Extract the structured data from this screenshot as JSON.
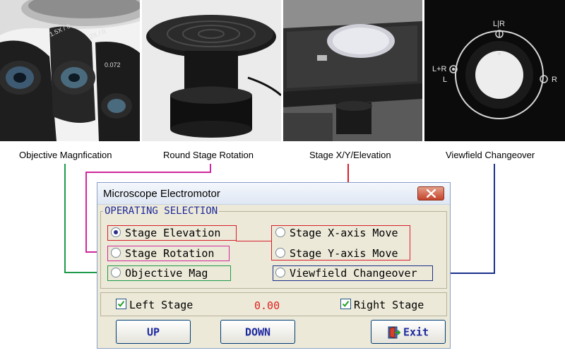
{
  "captions": {
    "objective": "Objective Magnfication",
    "round_stage": "Round Stage Rotation",
    "stage_xy": "Stage X/Y/Elevation",
    "viewfield": "Viewfield Changeover"
  },
  "photos": {
    "objective_label_a": "1.5X / 0",
    "objective_label_b": "2X / 0.",
    "objective_label_c": "0.072",
    "dial_top": "L|R",
    "dial_left_top": "L+R",
    "dial_left": "L",
    "dial_right": "R"
  },
  "dialog": {
    "title": "Microscope Electromotor",
    "group_label": "OPERATING SELECTION",
    "options": {
      "stage_elevation": "Stage Elevation",
      "stage_rotation": "Stage Rotation",
      "objective_mag": "Objective Mag",
      "stage_x": "Stage X-axis Move",
      "stage_y": "Stage Y-axis Move",
      "viewfield": "Viewfield Changeover"
    },
    "selected_option": "stage_elevation",
    "left_stage": {
      "label": "Left Stage",
      "checked": true
    },
    "right_stage": {
      "label": "Right Stage",
      "checked": true
    },
    "value": "0.00",
    "buttons": {
      "up": "UP",
      "down": "DOWN",
      "exit": "Exit"
    }
  },
  "colors": {
    "magenta": "#d0289a",
    "red": "#d81e2a",
    "green": "#1e9a4a",
    "navy": "#1a2f8c",
    "value_red": "#e02020"
  }
}
